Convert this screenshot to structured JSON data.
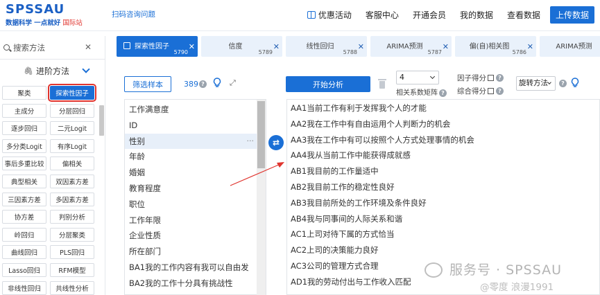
{
  "header": {
    "logo_main": "SPSSAU",
    "logo_sub": "数据科学 一点就好",
    "logo_intl": "国际站",
    "qr_link": "扫码咨询问题",
    "nav": [
      "优惠活动",
      "客服中心",
      "开通会员",
      "我的数据",
      "查看数据"
    ],
    "upload": "上传数据"
  },
  "sidebar": {
    "search_placeholder": "搜索方法",
    "advanced_label": "进阶方法",
    "methods": [
      "聚类",
      "探索性因子",
      "主成分",
      "分层回归",
      "逐步回归",
      "二元Logit",
      "多分类Logit",
      "有序Logit",
      "事后多重比较",
      "偏相关",
      "典型相关",
      "双因素方差",
      "三因素方差",
      "多因素方差",
      "协方差",
      "判别分析",
      "岭回归",
      "分层聚类",
      "曲线回归",
      "PLS回归",
      "Lasso回归",
      "RFM模型",
      "非线性回归",
      "共线性分析"
    ],
    "active_method": "探索性因子"
  },
  "tabs": [
    {
      "label": "探索性因子",
      "num": "5790",
      "active": true
    },
    {
      "label": "信度",
      "num": "5789",
      "active": false
    },
    {
      "label": "线性回归",
      "num": "5788",
      "active": false
    },
    {
      "label": "ARIMA预测",
      "num": "5787",
      "active": false
    },
    {
      "label": "偏(自)相关图",
      "num": "5786",
      "active": false
    },
    {
      "label": "ARIMA预测",
      "num": "",
      "active": false
    }
  ],
  "toolbar": {
    "filter_label": "筛选样本",
    "count": "389",
    "start_label": "开始分析",
    "factor_count": "4",
    "corr_label": "相关系数矩阵",
    "factor_score": "因子得分",
    "composite_score": "综合得分",
    "rotation": "旋转方法"
  },
  "variables": [
    "工作满意度",
    "ID",
    "性别",
    "年龄",
    "婚姻",
    "教育程度",
    "职位",
    "工作年限",
    "企业性质",
    "所在部门",
    "BA1我的工作内容有我可以自由发",
    "BA2我的工作十分具有挑战性"
  ],
  "selected_variable": "性别",
  "selected_items": [
    "AA1当前工作有利于发挥我个人的才能",
    "AA2我在工作中有自由运用个人判断力的机会",
    "AA3我在工作中有可以按照个人方式处理事情的机会",
    "AA4我从当前工作中能获得成就感",
    "AB1我目前的工作量适中",
    "AB2我目前工作的稳定性良好",
    "AB3我目前所处的工作环境及条件良好",
    "AB4我与同事间的人际关系和谐",
    "AC1上司对待下属的方式恰当",
    "AC2上司的决策能力良好",
    "AC3公司的管理方式合理",
    "AD1我的劳动付出与工作收入匹配"
  ],
  "watermark": {
    "line1": "服务号 · SPSSAU",
    "line2": "@零度 浪漫1991"
  },
  "colors": {
    "brand": "#1a6fd6",
    "annotation": "#e0342e"
  }
}
